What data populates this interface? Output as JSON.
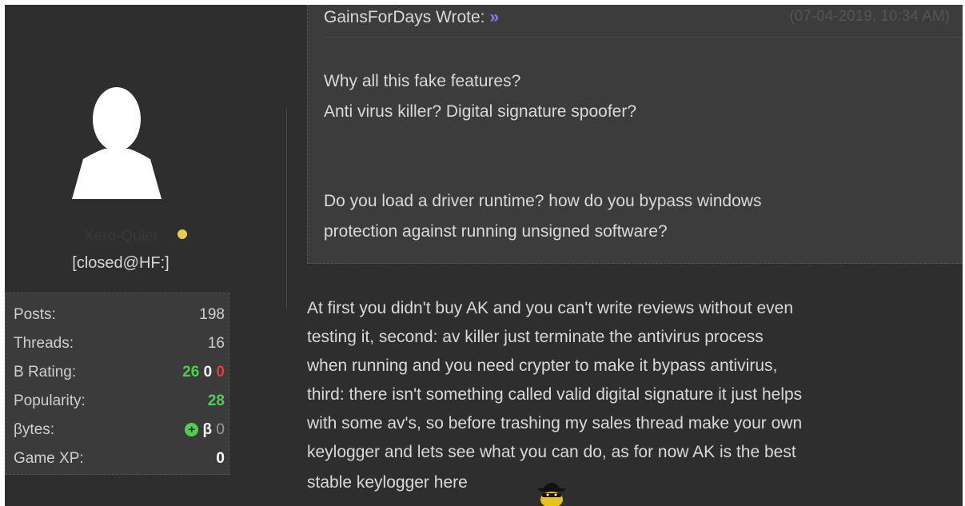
{
  "sidebar": {
    "username": "Xero-Quiet",
    "usertitle": "[closed@HF:]",
    "stats": [
      {
        "label": "Posts:",
        "value": "198"
      },
      {
        "label": "Threads:",
        "value": "16"
      },
      {
        "label": "B Rating:",
        "positive": "26",
        "neutral": "0",
        "negative": "0"
      },
      {
        "label": "Popularity:",
        "value": "28"
      },
      {
        "label": "βytes:",
        "symbol": "β",
        "value": "0"
      },
      {
        "label": "Game XP:",
        "value": "0"
      }
    ]
  },
  "quote": {
    "author_line": "GainsForDays Wrote:",
    "link_glyph": "»",
    "date": "(07-04-2019, 10:34 AM)",
    "lines": [
      "Why all this fake features?",
      "Anti virus killer? Digital signature spoofer?",
      "Do you load a driver runtime? how do you bypass windows",
      "protection against running unsigned software?"
    ]
  },
  "post": {
    "lines": [
      "At first you didn't buy AK and you can't write reviews without even",
      "testing it, second: av killer just terminate the antivirus process",
      "when running and you need crypter to make it bypass antivirus,",
      "third: there isn't something called valid digital signature it just helps",
      "with some av's, so before trashing my sales thread make your own",
      "keylogger and lets see what you can do, as for now AK is the best",
      "stable keylogger here"
    ],
    "smiley": "ninja-smiley-icon"
  },
  "colors": {
    "background": "#2e2e2e",
    "quote_bg": "#3c3c3c",
    "positive": "#4fcf4f",
    "negative": "#e33d3d",
    "online": "#e6cf4a",
    "link": "#8a7bff"
  }
}
